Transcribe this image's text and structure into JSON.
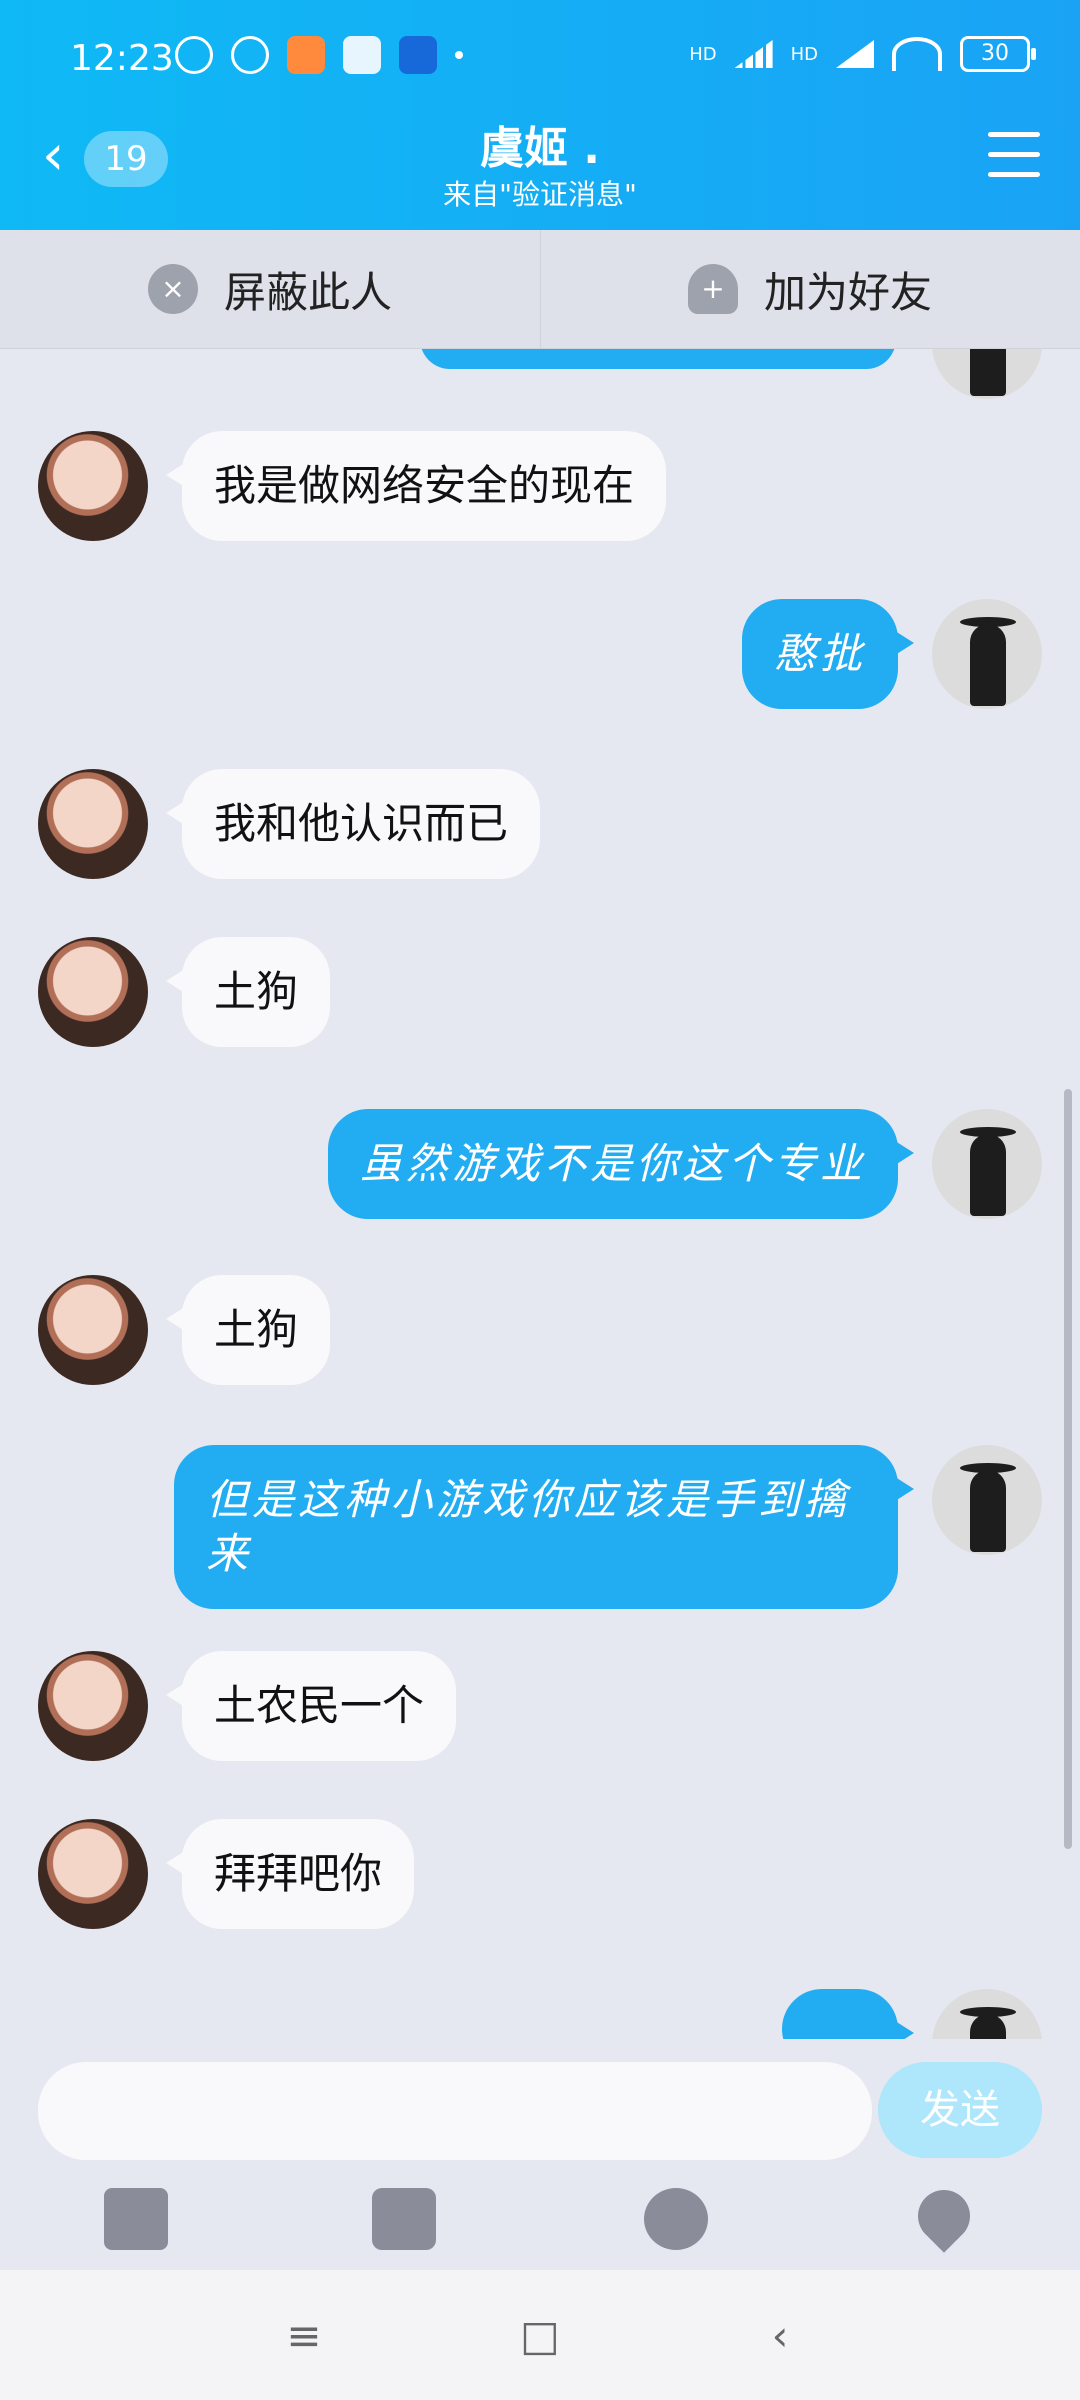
{
  "status_bar": {
    "time": "12:23",
    "battery": "30",
    "hd1": "HD",
    "hd2": "HD"
  },
  "header": {
    "back_count": "19",
    "title": "虞姬 .",
    "subtitle": "来自\"验证消息\""
  },
  "actions": {
    "block": "屏蔽此人",
    "add_friend": "加为好友"
  },
  "messages": [
    {
      "from": "other",
      "text": "我是做网络安全的现在"
    },
    {
      "from": "me",
      "text": "憨批"
    },
    {
      "from": "other",
      "text": "我和他认识而已"
    },
    {
      "from": "other",
      "text": "土狗"
    },
    {
      "from": "me",
      "text": "虽然游戏不是你这个专业"
    },
    {
      "from": "other",
      "text": "土狗"
    },
    {
      "from": "me",
      "text": "但是这种小游戏你应该是手到擒来"
    },
    {
      "from": "other",
      "text": "土农民一个"
    },
    {
      "from": "other",
      "text": "拜拜吧你"
    }
  ],
  "input": {
    "placeholder": "",
    "send_label": "发送"
  },
  "colors": {
    "header": "#19b4f6",
    "my_bubble": "#22acf1",
    "other_bubble": "#f9f9fb",
    "background": "#e6e8f1"
  }
}
